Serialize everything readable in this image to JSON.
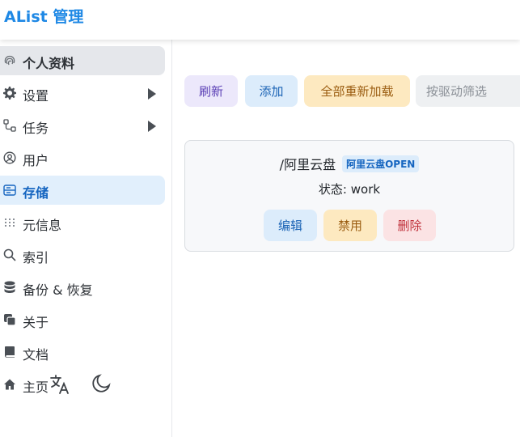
{
  "app": {
    "title": "AList 管理"
  },
  "sidebar": {
    "items": [
      {
        "label": "个人资料",
        "icon": "fingerprint-icon"
      },
      {
        "label": "设置",
        "icon": "gear-icon"
      },
      {
        "label": "任务",
        "icon": "workflow-icon"
      },
      {
        "label": "用户",
        "icon": "user-circle-icon"
      },
      {
        "label": "存储",
        "icon": "storage-icon"
      },
      {
        "label": "元信息",
        "icon": "grid-dots-icon"
      },
      {
        "label": "索引",
        "icon": "search-icon"
      },
      {
        "label": "备份 & 恢复",
        "icon": "database-icon"
      },
      {
        "label": "关于",
        "icon": "copy-icon"
      },
      {
        "label": "文档",
        "icon": "book-icon"
      },
      {
        "label": "主页",
        "icon": "home-icon"
      }
    ],
    "footer": {
      "language_icon": "translate-icon",
      "theme_icon": "moon-icon"
    }
  },
  "toolbar": {
    "refresh_label": "刷新",
    "add_label": "添加",
    "reload_all_label": "全部重新加载",
    "filter_placeholder": "按驱动筛选"
  },
  "storages": [
    {
      "mount_path": "/阿里云盘",
      "driver": "阿里云盘OPEN",
      "status_label": "状态:",
      "status_value": "work",
      "edit_label": "编辑",
      "disable_label": "禁用",
      "delete_label": "删除"
    }
  ]
}
